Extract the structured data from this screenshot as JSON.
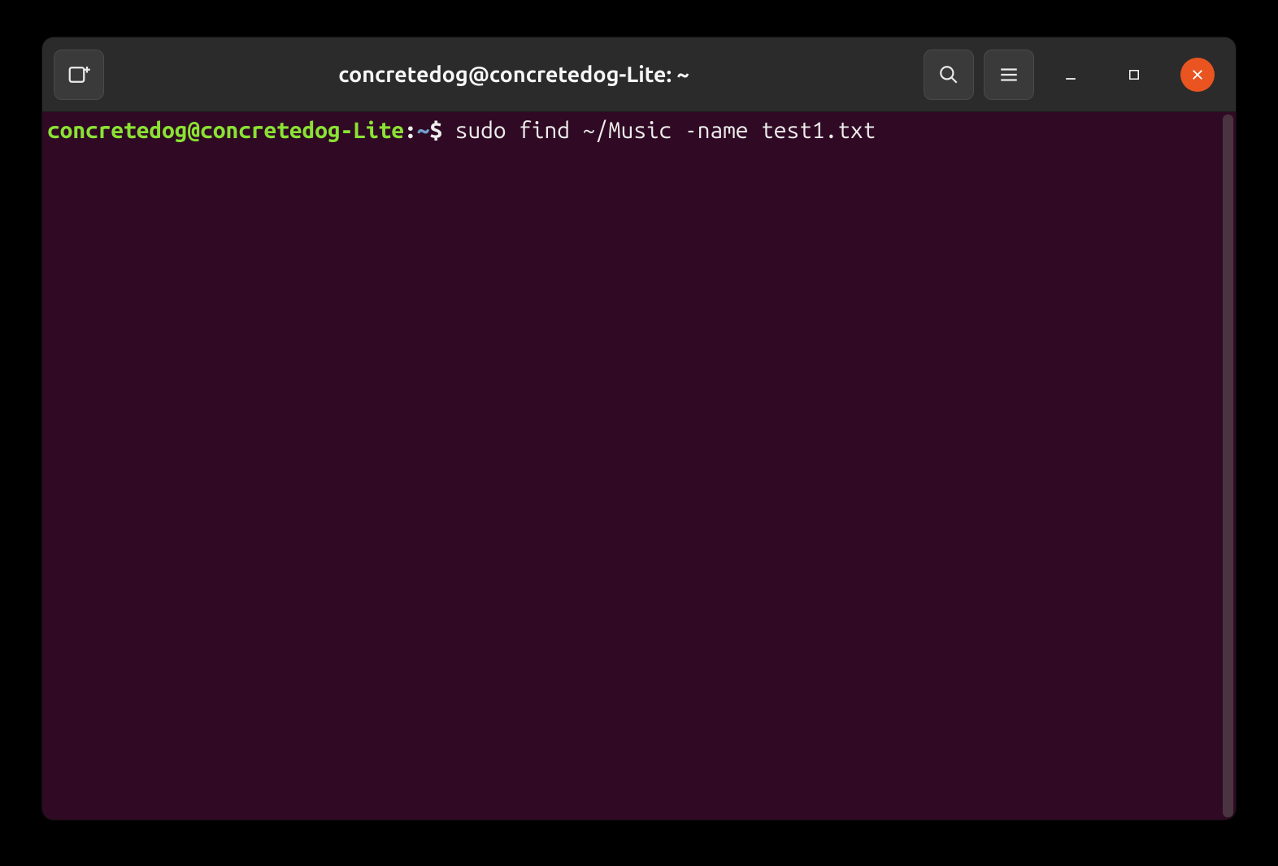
{
  "titlebar": {
    "title": "concretedog@concretedog-Lite: ~"
  },
  "prompt": {
    "user_host": "concretedog@concretedog-Lite",
    "sep1": ":",
    "cwd": "~",
    "sigil": "$ ",
    "command": "sudo find ~/Music -name test1.txt"
  },
  "colors": {
    "bg": "#300a24",
    "accent": "#e95420",
    "prompt_green": "#8ae234",
    "prompt_blue": "#729fcf"
  }
}
